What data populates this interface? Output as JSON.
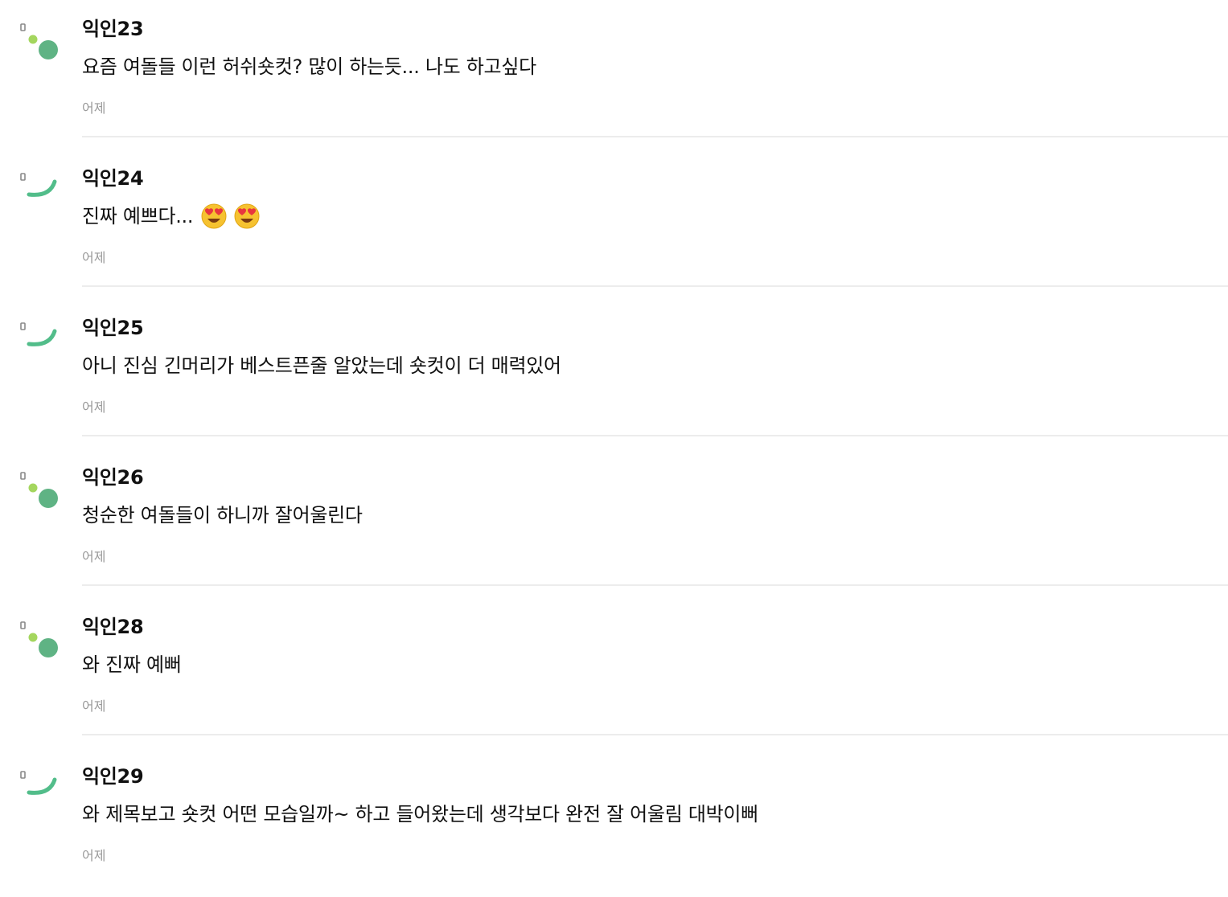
{
  "comments": [
    {
      "nickname": "익인23",
      "text": "요즘 여돌들 이런 허쉬숏컷? 많이 하는듯... 나도 하고싶다",
      "time": "어제",
      "avatar": "dots-avatar-icon"
    },
    {
      "nickname": "익인24",
      "text": "진짜 예쁘다...",
      "time": "어제",
      "avatar": "arc-avatar-icon",
      "emojis": [
        "heart-eyes-emoji",
        "heart-eyes-emoji"
      ]
    },
    {
      "nickname": "익인25",
      "text": "아니 진심 긴머리가 베스트픈줄 알았는데 숏컷이 더 매력있어",
      "time": "어제",
      "avatar": "arc-avatar-icon"
    },
    {
      "nickname": "익인26",
      "text": "청순한 여돌들이 하니까 잘어울린다",
      "time": "어제",
      "avatar": "dots-avatar-icon"
    },
    {
      "nickname": "익인28",
      "text": "와 진짜 예뻐",
      "time": "어제",
      "avatar": "dots-avatar-icon"
    },
    {
      "nickname": "익인29",
      "text": "와 제목보고 숏컷 어떤 모습일까~ 하고 들어왔는데 생각보다 완전 잘 어울림 대박이뻐",
      "time": "어제",
      "avatar": "arc-avatar-icon"
    }
  ],
  "colors": {
    "avatar_green": "#5fb384",
    "avatar_lime": "#a4d65e",
    "avatar_arc": "#52bd8a",
    "avatar_badge": "#8a8a8a",
    "divider": "#ececec",
    "time_text": "#999999"
  }
}
